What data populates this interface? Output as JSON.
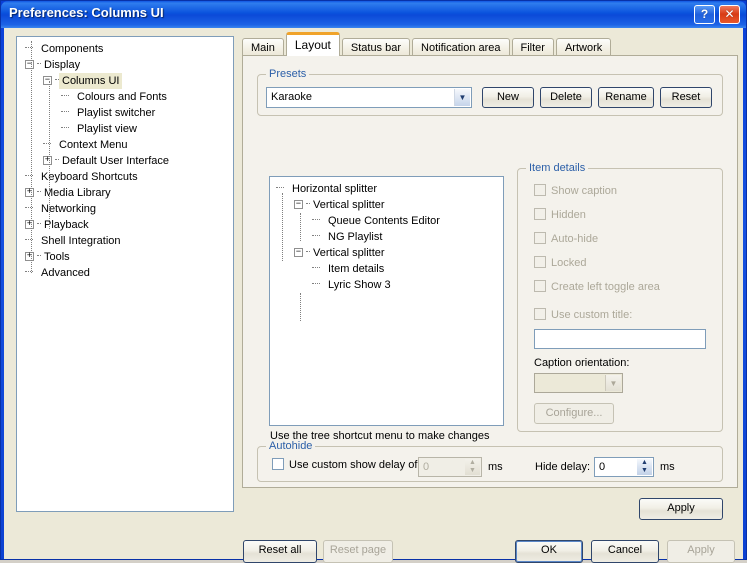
{
  "window": {
    "title": "Preferences: Columns UI",
    "help_button": "?",
    "close_button": "✕"
  },
  "sidebar": {
    "items": [
      {
        "label": "Components",
        "indent": 1,
        "toggle": "none",
        "selected": false
      },
      {
        "label": "Display",
        "indent": 1,
        "toggle": "expanded",
        "selected": false
      },
      {
        "label": "Columns UI",
        "indent": 2,
        "toggle": "expanded",
        "selected": true
      },
      {
        "label": "Colours and Fonts",
        "indent": 3,
        "toggle": "none",
        "selected": false
      },
      {
        "label": "Playlist switcher",
        "indent": 3,
        "toggle": "none",
        "selected": false
      },
      {
        "label": "Playlist view",
        "indent": 3,
        "toggle": "none",
        "selected": false
      },
      {
        "label": "Context Menu",
        "indent": 2,
        "toggle": "none",
        "selected": false
      },
      {
        "label": "Default User Interface",
        "indent": 2,
        "toggle": "collapsed",
        "selected": false
      },
      {
        "label": "Keyboard Shortcuts",
        "indent": 1,
        "toggle": "none",
        "selected": false
      },
      {
        "label": "Media Library",
        "indent": 1,
        "toggle": "collapsed",
        "selected": false
      },
      {
        "label": "Networking",
        "indent": 1,
        "toggle": "none",
        "selected": false
      },
      {
        "label": "Playback",
        "indent": 1,
        "toggle": "collapsed",
        "selected": false
      },
      {
        "label": "Shell Integration",
        "indent": 1,
        "toggle": "none",
        "selected": false
      },
      {
        "label": "Tools",
        "indent": 1,
        "toggle": "collapsed",
        "selected": false
      },
      {
        "label": "Advanced",
        "indent": 1,
        "toggle": "none",
        "selected": false
      }
    ]
  },
  "tabs": [
    {
      "label": "Main",
      "active": false
    },
    {
      "label": "Layout",
      "active": true
    },
    {
      "label": "Status bar",
      "active": false
    },
    {
      "label": "Notification area",
      "active": false
    },
    {
      "label": "Filter",
      "active": false
    },
    {
      "label": "Artwork",
      "active": false
    }
  ],
  "presets": {
    "legend": "Presets",
    "selected": "Karaoke",
    "dropdown_arrow": "▼",
    "buttons": [
      {
        "label": "New",
        "disabled": false
      },
      {
        "label": "Delete",
        "disabled": false
      },
      {
        "label": "Rename",
        "disabled": false
      },
      {
        "label": "Reset",
        "disabled": false
      }
    ]
  },
  "splitter_tree": {
    "hint": "Use the tree shortcut menu to make changes",
    "nodes": [
      {
        "label": "Horizontal splitter",
        "indent": 0,
        "toggle": "none"
      },
      {
        "label": "Vertical splitter",
        "indent": 1,
        "toggle": "expanded"
      },
      {
        "label": "Queue Contents Editor",
        "indent": 2,
        "toggle": "none"
      },
      {
        "label": "NG Playlist",
        "indent": 2,
        "toggle": "none"
      },
      {
        "label": "Vertical splitter",
        "indent": 1,
        "toggle": "expanded"
      },
      {
        "label": "Item details",
        "indent": 2,
        "toggle": "none"
      },
      {
        "label": "Lyric Show 3",
        "indent": 2,
        "toggle": "none"
      }
    ]
  },
  "item_details": {
    "legend": "Item details",
    "checkboxes": [
      {
        "label": "Show caption",
        "checked": false,
        "disabled": true
      },
      {
        "label": "Hidden",
        "checked": false,
        "disabled": true
      },
      {
        "label": "Auto-hide",
        "checked": false,
        "disabled": true
      },
      {
        "label": "Locked",
        "checked": false,
        "disabled": true
      },
      {
        "label": "Create left toggle area",
        "checked": false,
        "disabled": true
      },
      {
        "label": "Use custom title:",
        "checked": false,
        "disabled": true
      }
    ],
    "custom_title_value": "",
    "caption_orientation_label": "Caption orientation:",
    "caption_orientation_value": "",
    "caption_orientation_arrow": "▼",
    "configure_button": "Configure..."
  },
  "autohide": {
    "legend": "Autohide",
    "show_delay_checkbox": "Use custom show delay of",
    "show_delay_checked": false,
    "show_delay_value": "0",
    "show_delay_unit": "ms",
    "hide_delay_label": "Hide delay:",
    "hide_delay_value": "0",
    "hide_delay_unit": "ms",
    "spin_up": "▲",
    "spin_down": "▼"
  },
  "page_apply_button": "Apply",
  "footer": {
    "reset_all": "Reset all",
    "reset_page": "Reset page",
    "ok": "OK",
    "cancel": "Cancel",
    "apply": "Apply"
  },
  "colors": {
    "titlebar_blue": "#0b4ad8",
    "accent_orange": "#f0a32a",
    "legend_blue": "#2b5fa8",
    "dialog_face": "#ece9d8",
    "selection_beige": "#ece9cf"
  }
}
